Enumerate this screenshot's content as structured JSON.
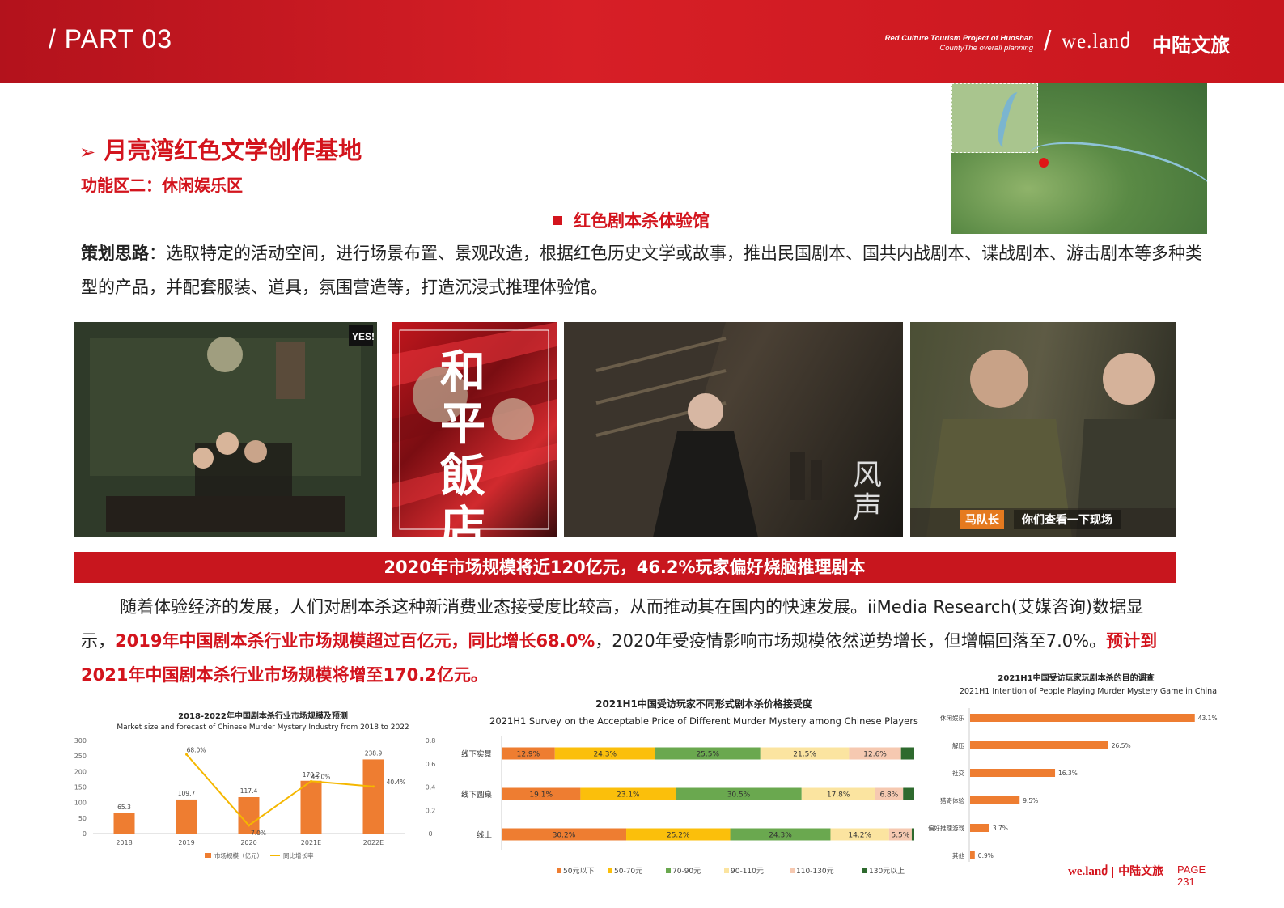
{
  "header": {
    "part": "/ PART 03",
    "tagline_line1": "Red Culture Tourism Project of Huoshan",
    "tagline_line2": "CountyThe overall planning",
    "slash": "/",
    "brand_en": "we.lanძ",
    "brand_cn": "中陆文旅"
  },
  "section": {
    "title": "月亮湾红色文学创作基地",
    "title_arrow": "➢",
    "subtitle": "功能区二：休闲娱乐区",
    "feature": "红色剧本杀体验馆"
  },
  "intro": {
    "label": "策划思路",
    "text": "：选取特定的活动空间，进行场景布置、景观改造，根据红色历史文学或故事，推出民国剧本、国共内战剧本、谍战剧本、游击剧本等多种类型的产品，并配套服装、道具，氛围营造等，打造沉浸式推理体验馆。"
  },
  "photos": {
    "poster_title": "和平飯店",
    "drama_sign": "风声",
    "subtitle_tag": "马队长",
    "subtitle_text": "你们查看一下现场",
    "wall_sign": "YES!"
  },
  "banner": "2020年市场规模将近120亿元，46.2%玩家偏好烧脑推理剧本",
  "body": {
    "p1": "随着体验经济的发展，人们对剧本杀这种新消费业态接受度比较高，从而推动其在国内的快速发展。iiMedia Research(艾媒咨询)数据显示，",
    "p1_red": "2019年中国剧本杀行业市场规模超过百亿元，同比增长68.0%",
    "p2": "，2020年受疫情影响市场规模依然逆势增长，但增幅回落至7.0%。",
    "p2_red": "预计到2021年中国剧本杀行业市场规模将增至170.2亿元。"
  },
  "chart_data": [
    {
      "type": "bar",
      "title": "2018-2022年中国剧本杀行业市场规模及预测",
      "subtitle": "Market size and forecast of Chinese Murder Mystery Industry from 2018 to 2022",
      "categories": [
        "2018",
        "2019",
        "2020",
        "2021E",
        "2022E"
      ],
      "series": [
        {
          "name": "市场规模（亿元）",
          "kind": "bar",
          "values": [
            65.3,
            109.7,
            117.4,
            170.2,
            238.9
          ],
          "color": "#ee7d31",
          "labels": [
            "65.3",
            "109.7",
            "117.4",
            "170.2",
            "238.9"
          ]
        },
        {
          "name": "同比增长率",
          "kind": "line",
          "axis": "right",
          "values": [
            null,
            0.68,
            0.07,
            0.45,
            0.404
          ],
          "color": "#f5b700",
          "labels": [
            "",
            "68.0%",
            "7.0%",
            "45.0%",
            "40.4%"
          ]
        }
      ],
      "ylim": [
        0,
        300
      ],
      "yticks": [
        "0",
        "50",
        "100",
        "150",
        "200",
        "250",
        "300"
      ],
      "y2lim": [
        0,
        0.8
      ],
      "y2ticks": [
        "0",
        "0.2",
        "0.4",
        "0.6",
        "0.8"
      ],
      "legend": "bottom"
    },
    {
      "type": "bar",
      "stacked": true,
      "orientation": "horizontal",
      "title": "2021H1中国受访玩家不同形式剧本杀价格接受度",
      "subtitle": "2021H1 Survey on the Acceptable Price of Different Murder Mystery among Chinese Players",
      "categories": [
        "线下实景",
        "线下圆桌",
        "线上"
      ],
      "series": [
        {
          "name": "50元以下",
          "color": "#ee7d31",
          "values": [
            12.9,
            19.1,
            30.2
          ],
          "labels": [
            "12.9%",
            "19.1%",
            "30.2%"
          ]
        },
        {
          "name": "50-70元",
          "color": "#fbbf0b",
          "values": [
            24.3,
            23.1,
            25.2
          ],
          "labels": [
            "24.3%",
            "23.1%",
            "25.2%"
          ]
        },
        {
          "name": "70-90元",
          "color": "#6aa84f",
          "values": [
            25.5,
            30.5,
            24.3
          ],
          "labels": [
            "25.5%",
            "30.5%",
            "24.3%"
          ]
        },
        {
          "name": "90-110元",
          "color": "#fbe4a0",
          "values": [
            21.5,
            17.8,
            14.2
          ],
          "labels": [
            "21.5%",
            "17.8%",
            "14.2%"
          ]
        },
        {
          "name": "110-130元",
          "color": "#f6c9b1",
          "values": [
            12.6,
            6.8,
            5.5
          ],
          "labels": [
            "12.6%",
            "6.8%",
            "5.5%"
          ]
        },
        {
          "name": "130元以上",
          "color": "#2e6a2e",
          "values": [
            3.2,
            2.7,
            0.6
          ],
          "labels": [
            "",
            "",
            ""
          ]
        }
      ],
      "xlim": [
        0,
        100
      ],
      "legend": "bottom"
    },
    {
      "type": "bar",
      "orientation": "horizontal",
      "title": "2021H1中国受访玩家玩剧本杀的目的调查",
      "subtitle": "2021H1 Intention of People Playing Murder Mystery Game in China",
      "categories": [
        "休闲娱乐",
        "解压",
        "社交",
        "猎奇体验",
        "偏好推理游戏",
        "其他"
      ],
      "values": [
        43.1,
        26.5,
        16.3,
        9.5,
        3.7,
        0.9
      ],
      "labels": [
        "43.1%",
        "26.5%",
        "16.3%",
        "9.5%",
        "3.7%",
        "0.9%"
      ],
      "color": "#ee7d31",
      "xlim": [
        0,
        45
      ]
    }
  ],
  "footer": {
    "brand_en": "we.lanძ",
    "brand_cn": "中陆文旅",
    "page_label": "PAGE",
    "page_number": "231"
  }
}
